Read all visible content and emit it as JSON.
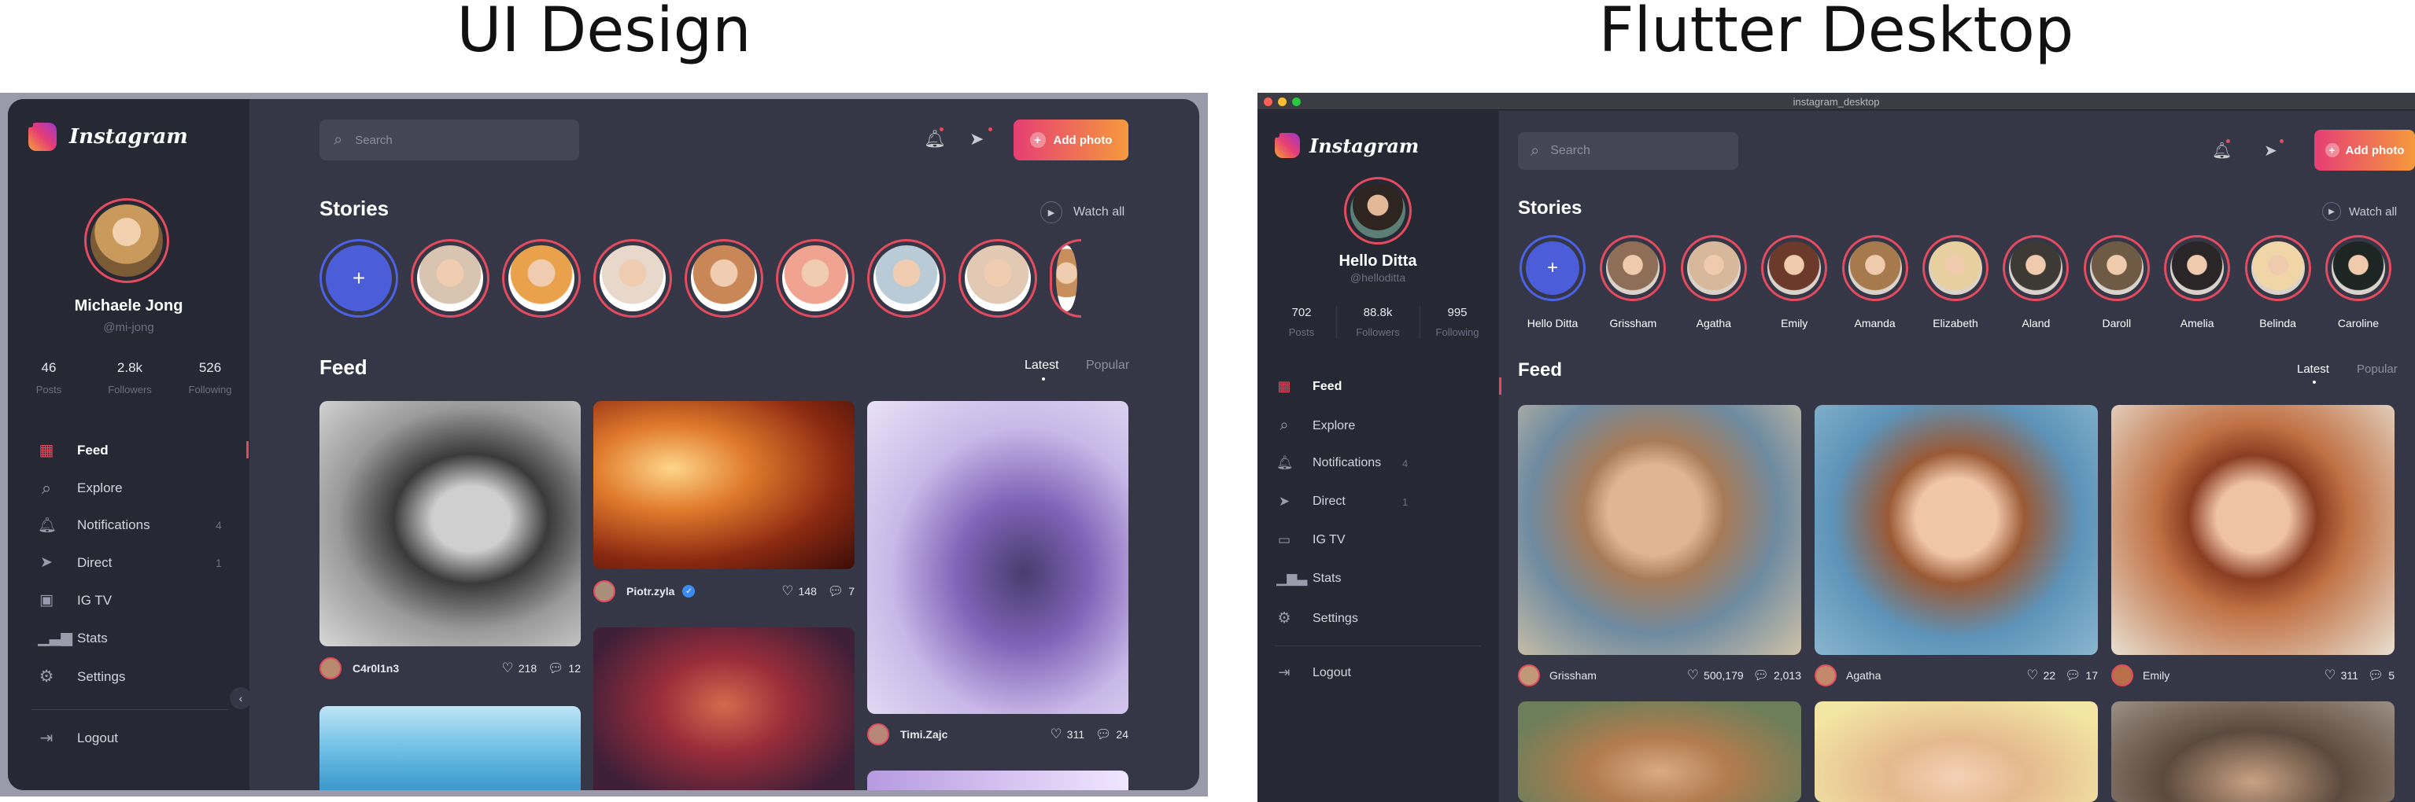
{
  "headings": {
    "left": "UI Design",
    "right": "Flutter Desktop"
  },
  "design": {
    "logo_text": "Instagram",
    "profile": {
      "name": "Michaele Jong",
      "handle": "@mi-jong",
      "stats": [
        {
          "value": "46",
          "label": "Posts"
        },
        {
          "value": "2.8k",
          "label": "Followers"
        },
        {
          "value": "526",
          "label": "Following"
        }
      ]
    },
    "nav": [
      {
        "label": "Feed",
        "icon": "grid-icon",
        "count": ""
      },
      {
        "label": "Explore",
        "icon": "search-icon",
        "count": ""
      },
      {
        "label": "Notifications",
        "icon": "bell-icon",
        "count": "4"
      },
      {
        "label": "Direct",
        "icon": "send-icon",
        "count": "1"
      },
      {
        "label": "IG TV",
        "icon": "tv-icon",
        "count": ""
      },
      {
        "label": "Stats",
        "icon": "stats-icon",
        "count": ""
      },
      {
        "label": "Settings",
        "icon": "gear-icon",
        "count": ""
      }
    ],
    "logout": "Logout",
    "search_placeholder": "Search",
    "add_photo": "Add photo",
    "stories_title": "Stories",
    "watch_all": "Watch all",
    "feed_title": "Feed",
    "tabs": [
      "Latest",
      "Popular"
    ],
    "posts": [
      {
        "user": "C4r0l1n3",
        "likes": "218",
        "comments": "12"
      },
      {
        "user": "Piotr.zyla",
        "likes": "148",
        "comments": "7"
      },
      {
        "user": "Timi.Zajc",
        "likes": "311",
        "comments": "24"
      }
    ]
  },
  "flutter": {
    "window_title": "instagram_desktop",
    "logo_text": "Instagram",
    "profile": {
      "name": "Hello Ditta",
      "handle": "@helloditta",
      "stats": [
        {
          "value": "702",
          "label": "Posts"
        },
        {
          "value": "88.8k",
          "label": "Followers"
        },
        {
          "value": "995",
          "label": "Following"
        }
      ]
    },
    "nav": [
      {
        "label": "Feed",
        "icon": "grid-icon",
        "count": ""
      },
      {
        "label": "Explore",
        "icon": "search-icon",
        "count": ""
      },
      {
        "label": "Notifications",
        "icon": "bell-icon",
        "count": "4"
      },
      {
        "label": "Direct",
        "icon": "send-icon",
        "count": "1"
      },
      {
        "label": "IG TV",
        "icon": "tv-icon",
        "count": ""
      },
      {
        "label": "Stats",
        "icon": "stats-icon",
        "count": ""
      },
      {
        "label": "Settings",
        "icon": "gear-icon",
        "count": ""
      }
    ],
    "logout": "Logout",
    "search_placeholder": "Search",
    "add_photo": "Add photo",
    "stories_title": "Stories",
    "watch_all": "Watch all",
    "stories": [
      "Hello Ditta",
      "Grissham",
      "Agatha",
      "Emily",
      "Amanda",
      "Elizabeth",
      "Aland",
      "Daroll",
      "Amelia",
      "Belinda",
      "Caroline"
    ],
    "feed_title": "Feed",
    "tabs": [
      "Latest",
      "Popular"
    ],
    "posts": [
      {
        "user": "Grissham",
        "likes": "500,179",
        "comments": "2,013"
      },
      {
        "user": "Agatha",
        "likes": "22",
        "comments": "17"
      },
      {
        "user": "Emily",
        "likes": "311",
        "comments": "5"
      }
    ]
  },
  "colors": {
    "accent": "#e44b5e",
    "story_add": "#4b5dd8",
    "bg_main": "#353747",
    "bg_side": "#262834"
  }
}
